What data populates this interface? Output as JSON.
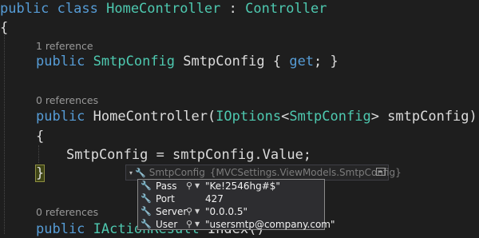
{
  "code": {
    "line1": {
      "kw1": "public",
      "kw2": "class",
      "name": "HomeController",
      "colon": " : ",
      "base": "Controller"
    },
    "line2": {
      "brace": "{"
    },
    "lens1": "1 reference",
    "line4": {
      "kw": "public",
      "type": "SmtpConfig",
      "rest": " SmtpConfig { ",
      "get": "get",
      "end": "; }"
    },
    "lens2": "0 references",
    "line6": {
      "kw": "public",
      "name": " HomeController(",
      "type1": "IOptions",
      "lt": "<",
      "type2": "SmtpConfig",
      "gt": ">",
      "rest": " smtpConfig)"
    },
    "line7": {
      "brace": "{"
    },
    "line8": {
      "text": "SmtpConfig = smtpConfig.Value;"
    },
    "line9": {
      "brace": "}"
    },
    "lens3": "0 references",
    "line10": {
      "kw": "public",
      "type": " IActionResult",
      "rest": " Index()"
    }
  },
  "datatip": {
    "header": {
      "type_name": "SmtpConfig",
      "full_type": "{MVCSettings.ViewModels.SmtpConfig}",
      "icon": "wrench-icon"
    },
    "rows": [
      {
        "name": "Pass",
        "value": "\"Ke!2546hg#$\"",
        "has_search": true,
        "icon": "wrench-icon"
      },
      {
        "name": "Port",
        "value": "427",
        "has_search": false,
        "icon": "wrench-icon"
      },
      {
        "name": "Server",
        "value": "\"0.0.0.5\"",
        "has_search": true,
        "icon": "wrench-icon"
      },
      {
        "name": "User",
        "value": "\"usersmtp@company.com\"",
        "has_search": true,
        "icon": "wrench-icon"
      }
    ]
  },
  "colors": {
    "background": "#1e1e1e",
    "keyword": "#569cd6",
    "type": "#4ec9b0",
    "text": "#dcdcdc",
    "codelens": "#999999"
  }
}
